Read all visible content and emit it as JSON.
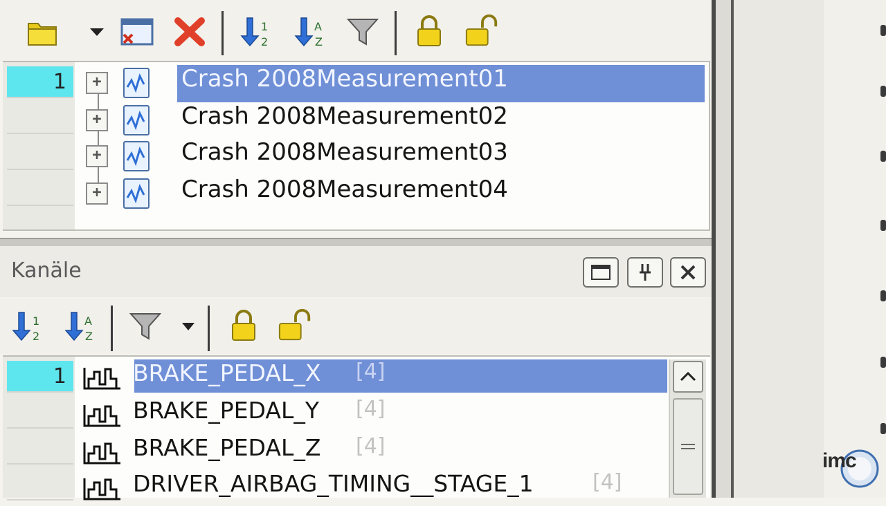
{
  "files_toolbar": {
    "icons": [
      "open-folder-icon",
      "dropdown-arrow-icon",
      "close-window-icon",
      "delete-icon",
      "sort-ascending-numeric-icon",
      "sort-ascending-alpha-icon",
      "filter-icon",
      "lock-icon",
      "unlock-icon"
    ]
  },
  "files": {
    "row_numbers": [
      "1",
      "",
      "",
      ""
    ],
    "items": [
      {
        "label": "Crash 2008Measurement01",
        "selected": true
      },
      {
        "label": "Crash 2008Measurement02",
        "selected": false
      },
      {
        "label": "Crash 2008Measurement03",
        "selected": false
      },
      {
        "label": "Crash 2008Measurement04",
        "selected": false
      }
    ]
  },
  "channels": {
    "title": "Kanäle",
    "window_buttons": [
      "maximize-icon",
      "pin-icon",
      "close-icon"
    ],
    "toolbar_icons": [
      "sort-ascending-numeric-icon",
      "sort-ascending-alpha-icon",
      "filter-icon",
      "dropdown-arrow-icon",
      "lock-icon",
      "unlock-icon"
    ],
    "row_numbers": [
      "1",
      "",
      "",
      ""
    ],
    "items": [
      {
        "name": "BRAKE_PEDAL_X",
        "size": "[4]",
        "selected": true
      },
      {
        "name": "BRAKE_PEDAL_Y",
        "size": "[4]",
        "selected": false
      },
      {
        "name": "BRAKE_PEDAL_Z",
        "size": "[4]",
        "selected": false
      },
      {
        "name": "DRIVER_AIRBAG_TIMING__STAGE_1",
        "size": "[4]",
        "selected": false
      }
    ]
  },
  "logo": {
    "text": "imc"
  },
  "colors": {
    "selection": "#6f8fd6",
    "active_row": "#5ee6ee",
    "lock_yellow": "#f2d21b",
    "arrow_blue": "#2f6fd6",
    "delete_red": "#e0402a"
  }
}
